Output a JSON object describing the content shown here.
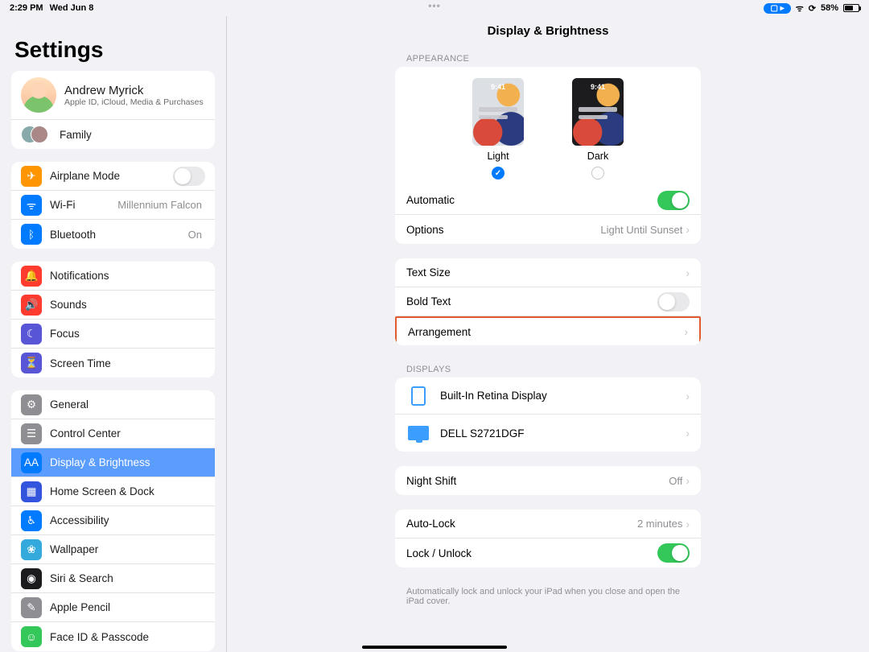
{
  "status": {
    "time": "2:29 PM",
    "date": "Wed Jun 8",
    "battery_pct": "58%"
  },
  "sidebar": {
    "title": "Settings",
    "profile": {
      "name": "Andrew Myrick",
      "sub": "Apple ID, iCloud, Media & Purchases"
    },
    "family_label": "Family",
    "group1": {
      "airplane": "Airplane Mode",
      "wifi": "Wi-Fi",
      "wifi_detail": "Millennium Falcon",
      "bt": "Bluetooth",
      "bt_detail": "On"
    },
    "group2": {
      "notifications": "Notifications",
      "sounds": "Sounds",
      "focus": "Focus",
      "screentime": "Screen Time"
    },
    "group3": {
      "general": "General",
      "control_center": "Control Center",
      "display": "Display & Brightness",
      "home_dock": "Home Screen & Dock",
      "accessibility": "Accessibility",
      "wallpaper": "Wallpaper",
      "siri": "Siri & Search",
      "pencil": "Apple Pencil",
      "faceid": "Face ID & Passcode"
    }
  },
  "page": {
    "title": "Display & Brightness",
    "appearance_header": "APPEARANCE",
    "light": "Light",
    "dark": "Dark",
    "preview_time": "9:41",
    "automatic": "Automatic",
    "options": "Options",
    "options_detail": "Light Until Sunset",
    "text_size": "Text Size",
    "bold_text": "Bold Text",
    "arrangement": "Arrangement",
    "displays_header": "DISPLAYS",
    "builtin": "Built-In Retina Display",
    "external": "DELL S2721DGF",
    "night_shift": "Night Shift",
    "night_shift_detail": "Off",
    "auto_lock": "Auto-Lock",
    "auto_lock_detail": "2 minutes",
    "lock_unlock": "Lock / Unlock",
    "footer": "Automatically lock and unlock your iPad when you close and open the iPad cover."
  }
}
